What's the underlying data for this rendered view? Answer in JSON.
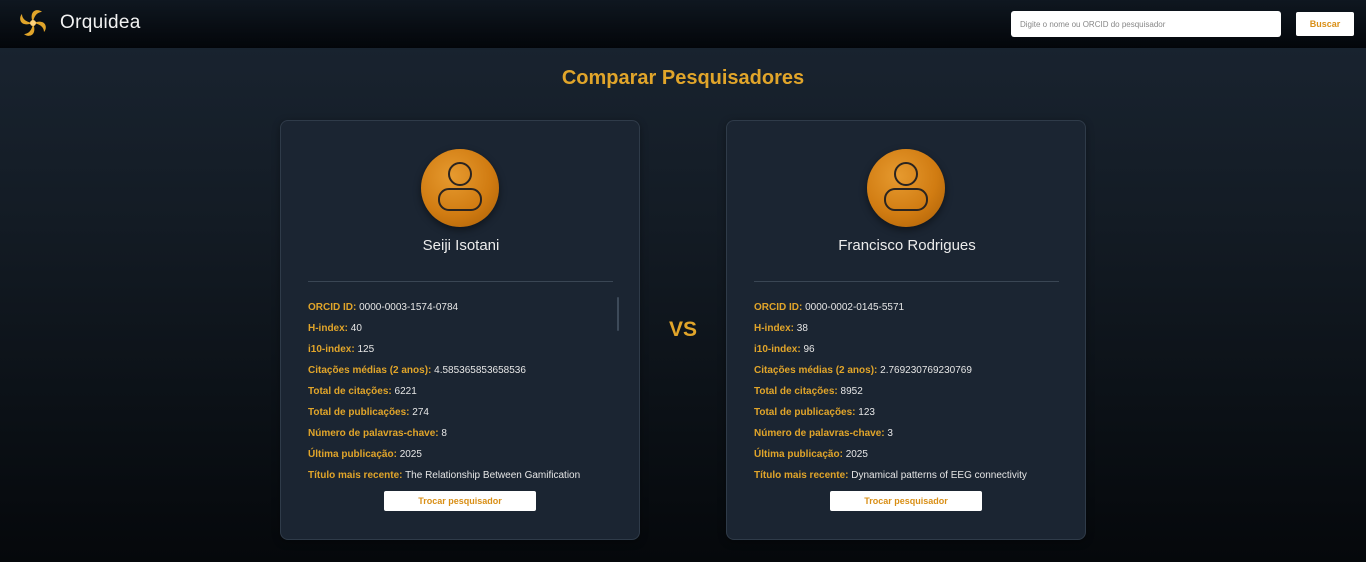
{
  "header": {
    "brand": "Orquidea",
    "search_placeholder": "Digite o nome ou ORCID do pesquisador",
    "search_button": "Buscar"
  },
  "page_title": "Comparar Pesquisadores",
  "vs_label": "VS",
  "colors": {
    "accent": "#e1a52a",
    "avatar": "#d17c12",
    "card_bg": "#1b2532"
  },
  "researchers": [
    {
      "name": "Seiji Isotani",
      "avatar_icon": "user-icon",
      "fields": [
        {
          "label": "ORCID ID:",
          "value": "0000-0003-1574-0784"
        },
        {
          "label": "H-index:",
          "value": "40"
        },
        {
          "label": "i10-index:",
          "value": "125"
        },
        {
          "label": "Citações médias (2 anos):",
          "value": "4.585365853658536"
        },
        {
          "label": "Total de citações:",
          "value": "6221"
        },
        {
          "label": "Total de publicações:",
          "value": "274"
        },
        {
          "label": "Número de palavras-chave:",
          "value": "8"
        },
        {
          "label": "Última publicação:",
          "value": "2025"
        },
        {
          "label": "Título mais recente:",
          "value": "The Relationship Between Gamification"
        }
      ],
      "swap_button": "Trocar pesquisador"
    },
    {
      "name": "Francisco Rodrigues",
      "avatar_icon": "user-icon",
      "fields": [
        {
          "label": "ORCID ID:",
          "value": "0000-0002-0145-5571"
        },
        {
          "label": "H-index:",
          "value": "38"
        },
        {
          "label": "i10-index:",
          "value": "96"
        },
        {
          "label": "Citações médias (2 anos):",
          "value": "2.769230769230769"
        },
        {
          "label": "Total de citações:",
          "value": "8952"
        },
        {
          "label": "Total de publicações:",
          "value": "123"
        },
        {
          "label": "Número de palavras-chave:",
          "value": "3"
        },
        {
          "label": "Última publicação:",
          "value": "2025"
        },
        {
          "label": "Título mais recente:",
          "value": "Dynamical patterns of EEG connectivity"
        }
      ],
      "swap_button": "Trocar pesquisador"
    }
  ]
}
